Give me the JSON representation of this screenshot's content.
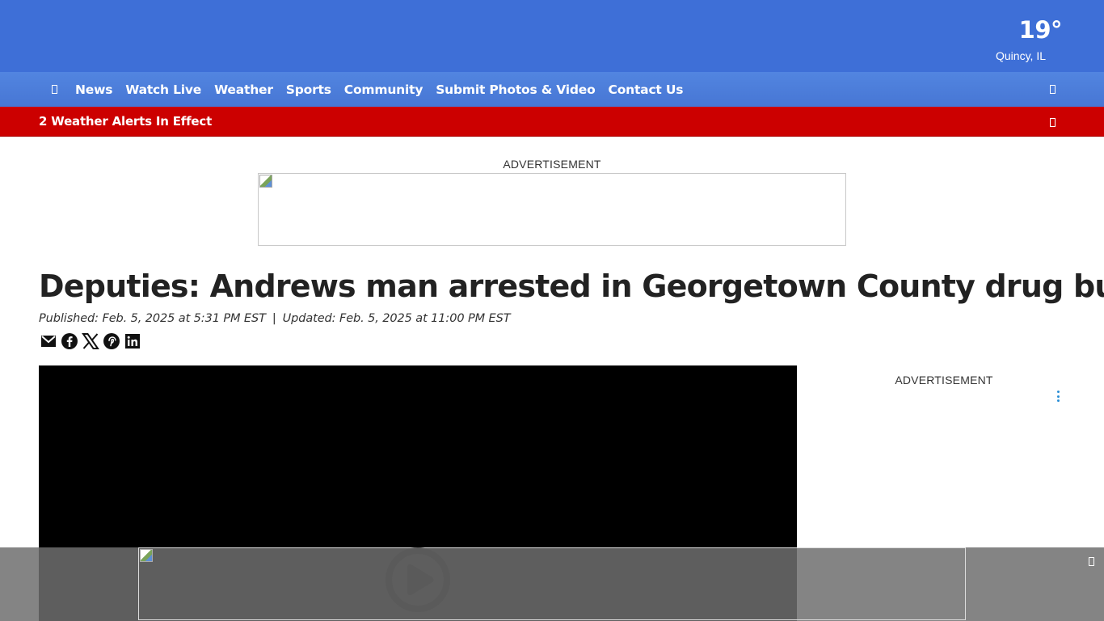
{
  "weather": {
    "temperature": "19°",
    "location": "Quincy, IL"
  },
  "nav": {
    "home_icon": "home-icon",
    "items": [
      {
        "label": "News"
      },
      {
        "label": "Watch Live"
      },
      {
        "label": "Weather"
      },
      {
        "label": "Sports"
      },
      {
        "label": "Community"
      },
      {
        "label": "Submit Photos & Video"
      },
      {
        "label": "Contact Us"
      }
    ],
    "search_icon": "search-icon"
  },
  "alert": {
    "text": "2 Weather Alerts In Effect",
    "toggle_icon": "chevron-down-icon"
  },
  "ads": {
    "top_label": "ADVERTISEMENT",
    "side_label": "ADVERTISEMENT"
  },
  "article": {
    "headline": "Deputies: Andrews man arrested in Georgetown County drug bust",
    "published": "Published: Feb. 5, 2025 at 5:31 PM EST",
    "separator": "|",
    "updated": "Updated: Feb. 5, 2025 at 11:00 PM EST",
    "share": [
      "email-icon",
      "facebook-icon",
      "x-icon",
      "pinterest-icon",
      "linkedin-icon"
    ]
  },
  "colors": {
    "header": "#3e6fd7",
    "nav": "#4a7bd8",
    "alert": "#cc0000",
    "video": "#000000"
  }
}
